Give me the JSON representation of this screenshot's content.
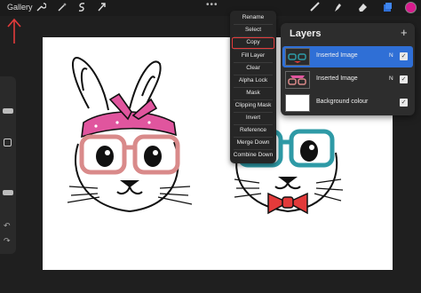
{
  "toolbar": {
    "gallery_label": "Gallery",
    "more_label": "•••",
    "color_active": "#d81b8d",
    "tools": [
      "wrench-icon",
      "magic-wand-icon",
      "selection-s-icon",
      "transform-arrow-icon",
      "brush-icon",
      "smudge-icon",
      "eraser-icon",
      "layers-icon"
    ]
  },
  "annotation": {
    "arrow_color": "#e23b3b"
  },
  "context_menu": {
    "items": [
      "Rename",
      "Select",
      "Copy",
      "Fill Layer",
      "Clear",
      "Alpha Lock",
      "Mask",
      "Clipping Mask",
      "Invert",
      "Reference",
      "Merge Down",
      "Combine Down"
    ],
    "highlighted": "Copy",
    "highlight_color": "#e23b3b"
  },
  "layers": {
    "title": "Layers",
    "add_label": "+",
    "items": [
      {
        "name": "Inserted Image",
        "blend": "N",
        "visible": true,
        "active": true
      },
      {
        "name": "Inserted Image",
        "blend": "N",
        "visible": true,
        "active": false
      },
      {
        "name": "Background colour",
        "blend": "",
        "visible": true,
        "active": false
      }
    ],
    "active_color": "#2f6fd6"
  },
  "canvas": {
    "bunny_left_colors": {
      "bandana": "#e0559e",
      "glasses": "#d98a8a"
    },
    "bunny_right_colors": {
      "glasses": "#2e9aa6",
      "bowtie": "#e33a3a"
    }
  }
}
